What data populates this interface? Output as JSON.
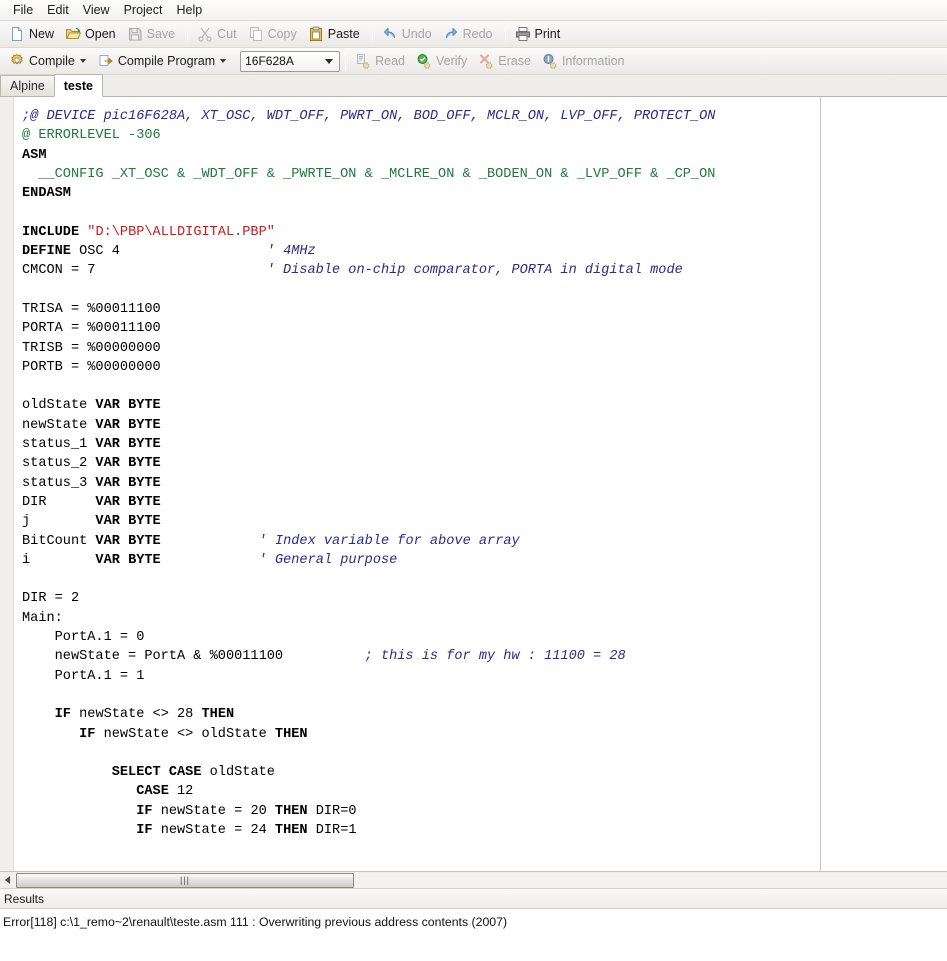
{
  "menubar": {
    "items": [
      {
        "label": "File"
      },
      {
        "label": "Edit"
      },
      {
        "label": "View"
      },
      {
        "label": "Project"
      },
      {
        "label": "Help"
      }
    ]
  },
  "toolbar_main": {
    "buttons": [
      {
        "label": "New",
        "icon": "new-document-icon",
        "enabled": true
      },
      {
        "label": "Open",
        "icon": "open-folder-icon",
        "enabled": true
      },
      {
        "label": "Save",
        "icon": "floppy-disk-icon",
        "enabled": false
      },
      {
        "label": "Cut",
        "icon": "scissors-icon",
        "enabled": false
      },
      {
        "label": "Copy",
        "icon": "copy-pages-icon",
        "enabled": false
      },
      {
        "label": "Paste",
        "icon": "clipboard-icon",
        "enabled": true
      },
      {
        "label": "Undo",
        "icon": "undo-arrow-icon",
        "enabled": false
      },
      {
        "label": "Redo",
        "icon": "redo-arrow-icon",
        "enabled": false
      },
      {
        "label": "Print",
        "icon": "printer-icon",
        "enabled": true
      }
    ]
  },
  "toolbar_compile": {
    "compile_label": "Compile",
    "compile_program_label": "Compile Program",
    "device_value": "16F628A",
    "buttons": [
      {
        "label": "Read",
        "icon": "read-chip-icon",
        "enabled": false
      },
      {
        "label": "Verify",
        "icon": "verify-check-icon",
        "enabled": false
      },
      {
        "label": "Erase",
        "icon": "erase-icon",
        "enabled": false
      },
      {
        "label": "Information",
        "icon": "info-icon",
        "enabled": false
      }
    ]
  },
  "tabs": [
    {
      "label": "Alpine",
      "active": false
    },
    {
      "label": "teste",
      "active": true
    }
  ],
  "editor": {
    "code_lines": [
      ";@ DEVICE pic16F628A, XT_OSC, WDT_OFF, PWRT_ON, BOD_OFF, MCLR_ON, LVP_OFF, PROTECT_ON",
      "@ ERRORLEVEL -306",
      "ASM",
      "  __CONFIG _XT_OSC & _WDT_OFF & _PWRTE_ON & _MCLRE_ON & _BODEN_ON & _LVP_OFF & _CP_ON",
      "ENDASM",
      "",
      "INCLUDE \"D:\\PBP\\ALLDIGITAL.PBP\"",
      "DEFINE OSC 4                  ' 4MHz",
      "CMCON = 7                     ' Disable on-chip comparator, PORTA in digital mode",
      "",
      "TRISA = %00011100",
      "PORTA = %00011100",
      "TRISB = %00000000",
      "PORTB = %00000000",
      "",
      "oldState VAR BYTE",
      "newState VAR BYTE",
      "status_1 VAR BYTE",
      "status_2 VAR BYTE",
      "status_3 VAR BYTE",
      "DIR      VAR BYTE",
      "j        VAR BYTE",
      "BitCount VAR BYTE            ' Index variable for above array",
      "i        VAR BYTE            ' General purpose",
      "",
      "DIR = 2",
      "Main:",
      "    PortA.1 = 0",
      "    newState = PortA & %00011100          ; this is for my hw : 11100 = 28",
      "    PortA.1 = 1",
      "",
      "    IF newState <> 28 THEN",
      "       IF newState <> oldState THEN",
      "",
      "           SELECT CASE oldState",
      "              CASE 12",
      "              IF newState = 20 THEN DIR=0",
      "              IF newState = 24 THEN DIR=1"
    ]
  },
  "scrollbar": {
    "grip": "|||"
  },
  "results": {
    "header": "Results",
    "lines": [
      "Error[118] c:\\1_remo~2\\renault\\teste.asm 111 : Overwriting previous address contents (2007)"
    ]
  },
  "colors": {
    "comment": "#2b2b8f",
    "green": "#1f7a3d",
    "string": "#cc1b1b",
    "keyword": "#000000"
  }
}
